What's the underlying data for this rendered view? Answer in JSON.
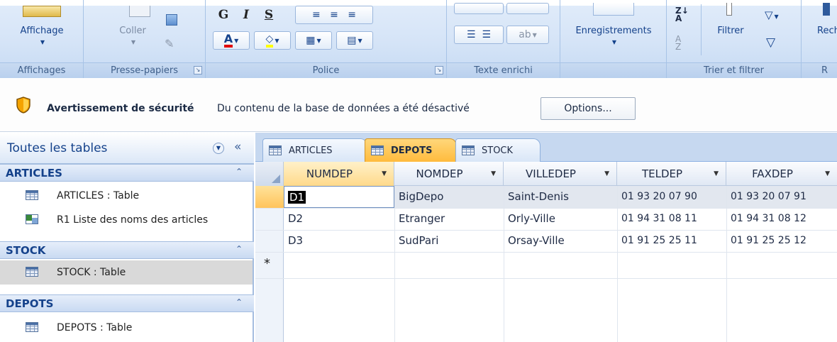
{
  "ribbon": {
    "groups": {
      "views": {
        "label": "Affichages",
        "view_btn": "Affichage"
      },
      "clipboard": {
        "label": "Presse-papiers",
        "paste_btn": "Coller"
      },
      "font": {
        "label": "Police",
        "bold": "G",
        "italic": "I",
        "underline": "S"
      },
      "rich_text": {
        "label": "Texte enrichi"
      },
      "records": {
        "label": "",
        "records_btn": "Enregistrements"
      },
      "sort_filter": {
        "label": "Trier et filtrer",
        "filter_btn": "Filtrer"
      },
      "find": {
        "label": "R",
        "find_btn": "Rech"
      }
    }
  },
  "security": {
    "title": "Avertissement de sécurité",
    "message": "Du contenu de la base de données a été désactivé",
    "options_btn": "Options..."
  },
  "nav": {
    "title": "Toutes les tables",
    "collapse": "«",
    "groups": [
      {
        "name": "ARTICLES",
        "items": [
          {
            "label": "ARTICLES : Table",
            "icon": "table-icon"
          },
          {
            "label": "R1 Liste des noms des articles",
            "icon": "query-icon"
          }
        ]
      },
      {
        "name": "STOCK",
        "items": [
          {
            "label": "STOCK : Table",
            "icon": "table-icon",
            "selected": true
          }
        ]
      },
      {
        "name": "DEPOTS",
        "items": [
          {
            "label": "DEPOTS : Table",
            "icon": "table-icon"
          }
        ]
      }
    ]
  },
  "tabs": [
    {
      "label": "ARTICLES",
      "active": false
    },
    {
      "label": "DEPOTS",
      "active": true
    },
    {
      "label": "STOCK",
      "active": false
    }
  ],
  "sheet": {
    "columns": [
      "NUMDEP",
      "NOMDEP",
      "VILLEDEP",
      "TELDEP",
      "FAXDEP"
    ],
    "rows": [
      [
        "D1",
        "BigDepo",
        "Saint-Denis",
        "01 93 20 07 90",
        "01 93 20 07 91"
      ],
      [
        "D2",
        "Etranger",
        "Orly-Ville",
        "01 94 31 08 11",
        "01 94 31 08 12"
      ],
      [
        "D3",
        "SudPari",
        "Orsay-Ville",
        "01 91 25 25 11",
        "01 91 25 25 12"
      ]
    ],
    "new_row_marker": "*"
  },
  "colors": {
    "accent": "#ffbb3d",
    "ribbon": "#d5e4f7",
    "text": "#15428b"
  }
}
